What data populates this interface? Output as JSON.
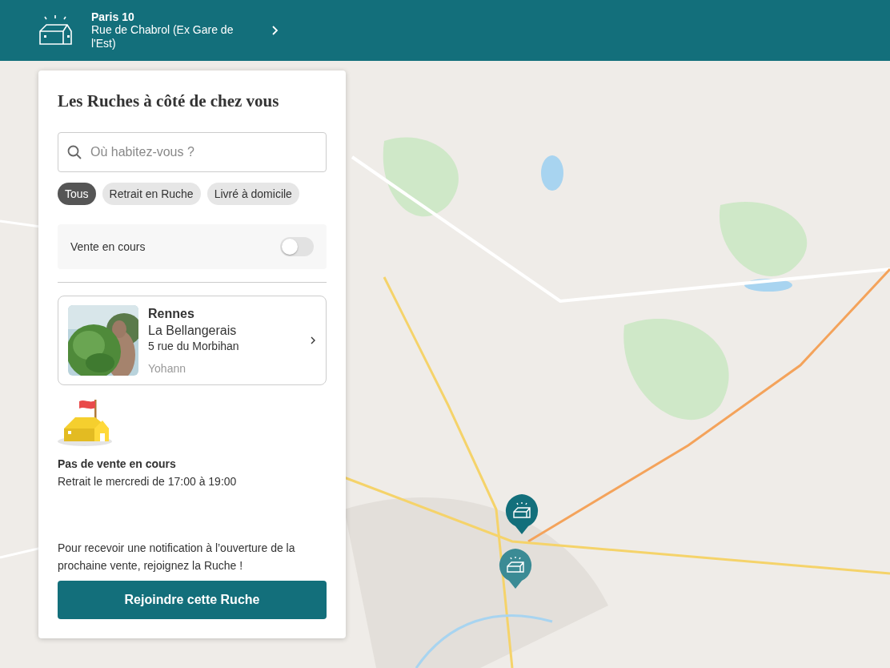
{
  "header": {
    "title": "Paris 10",
    "subtitle": "Rue de Chabrol (Ex Gare de l'Est)"
  },
  "map": {
    "pins": [
      {
        "selected": true
      },
      {
        "selected": false
      }
    ]
  },
  "panel": {
    "title": "Les Ruches à côté de chez vous",
    "search": {
      "placeholder": "Où habitez-vous ?"
    },
    "filters": [
      {
        "label": "Tous",
        "selected": true
      },
      {
        "label": "Retrait en Ruche",
        "selected": false
      },
      {
        "label": "Livré à domicile",
        "selected": false
      }
    ],
    "toggle": {
      "label": "Vente en cours",
      "on": false
    },
    "hive": {
      "city": "Rennes",
      "name": "La Bellangerais",
      "address": "5 rue du Morbihan",
      "host": "Yohann"
    },
    "status": {
      "title": "Pas de vente en cours",
      "schedule": "Retrait le mercredi de 17:00 à 19:00"
    },
    "notice": "Pour recevoir une notification à l’ouverture de la prochaine vente, rejoignez la Ruche !",
    "join_button": "Rejoindre cette Ruche"
  }
}
